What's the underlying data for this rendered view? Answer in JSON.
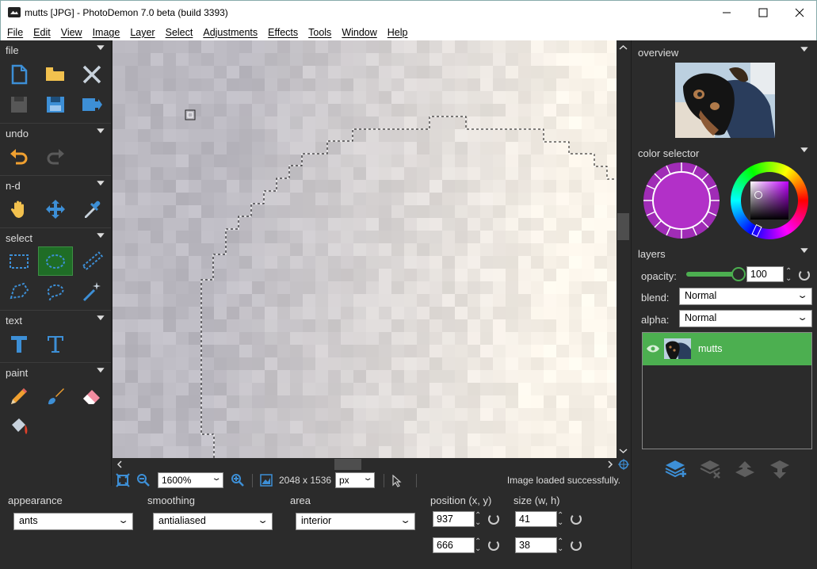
{
  "window": {
    "title": "mutts [JPG]  -  PhotoDemon 7.0 beta (build 3393)"
  },
  "menu": [
    "File",
    "Edit",
    "View",
    "Image",
    "Layer",
    "Select",
    "Adjustments",
    "Effects",
    "Tools",
    "Window",
    "Help"
  ],
  "toolbox": {
    "file": "file",
    "undo": "undo",
    "nd": "n-d",
    "select": "select",
    "text": "text",
    "paint": "paint"
  },
  "statusbar": {
    "zoom": "1600%",
    "dimensions": "2048 x 1536",
    "unit": "px",
    "message": "Image loaded successfully."
  },
  "panels": {
    "overview": "overview",
    "color_selector": "color selector",
    "layers": "layers",
    "opacity_label": "opacity:",
    "opacity_value": "100",
    "opacity_level": 1.0,
    "blend_label": "blend:",
    "blend_value": "Normal",
    "alpha_label": "alpha:",
    "alpha_value": "Normal",
    "layer_name": "mutts"
  },
  "options": {
    "appearance_label": "appearance",
    "appearance_value": "ants",
    "smoothing_label": "smoothing",
    "smoothing_value": "antialiased",
    "area_label": "area",
    "area_value": "interior",
    "position_label": "position (x, y)",
    "pos_x": "937",
    "pos_y": "666",
    "size_label": "size (w, h)",
    "size_w": "41",
    "size_h": "38"
  },
  "colors": {
    "accent_green": "#4caf50",
    "tool_blue": "#3d8fd6",
    "primary_color": "#b230c8"
  }
}
